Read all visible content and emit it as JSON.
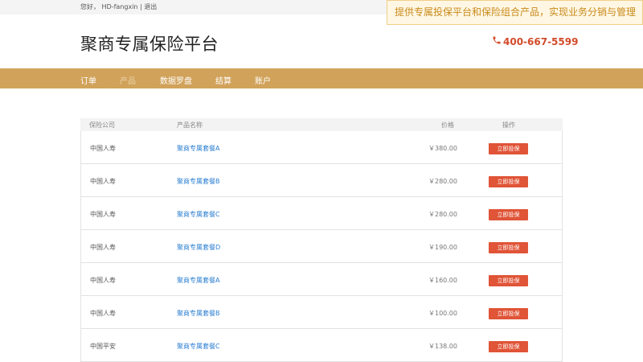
{
  "topbar": {
    "greeting": "您好，",
    "username": "HD-fangxin",
    "separator": "|",
    "logout": "退出"
  },
  "promo": {
    "text": "提供专属投保平台和保险组合产品，实现业务分销与管理"
  },
  "header": {
    "title": "聚商专属保险平台",
    "phone": "400-667-5599",
    "phone_icon": "phone-icon"
  },
  "nav": {
    "items": [
      {
        "label": "订单"
      },
      {
        "label": "产品"
      },
      {
        "label": "数据罗盘"
      },
      {
        "label": "结算"
      },
      {
        "label": "账户"
      }
    ]
  },
  "table": {
    "columns": [
      "保险公司",
      "产品名称",
      "价格",
      "操作"
    ],
    "rows": [
      {
        "company": "中国人寿",
        "product": "聚商专属套餐A",
        "price": "￥380.00",
        "action": "立即投保"
      },
      {
        "company": "中国人寿",
        "product": "聚商专属套餐B",
        "price": "￥280.00",
        "action": "立即投保"
      },
      {
        "company": "中国人寿",
        "product": "聚商专属套餐C",
        "price": "￥280.00",
        "action": "立即投保"
      },
      {
        "company": "中国人寿",
        "product": "聚商专属套餐D",
        "price": "￥190.00",
        "action": "立即投保"
      },
      {
        "company": "中国人寿",
        "product": "聚商专属套餐A",
        "price": "￥160.00",
        "action": "立即投保"
      },
      {
        "company": "中国人寿",
        "product": "聚商专属套餐B",
        "price": "￥100.00",
        "action": "立即投保"
      },
      {
        "company": "中国平安",
        "product": "聚商专属套餐C",
        "price": "￥138.00",
        "action": "立即投保"
      }
    ]
  },
  "colors": {
    "nav_bg": "#d1a25a",
    "accent_red": "#e05437",
    "link_blue": "#2b7fd1",
    "promo_bg": "#fff7e3"
  }
}
